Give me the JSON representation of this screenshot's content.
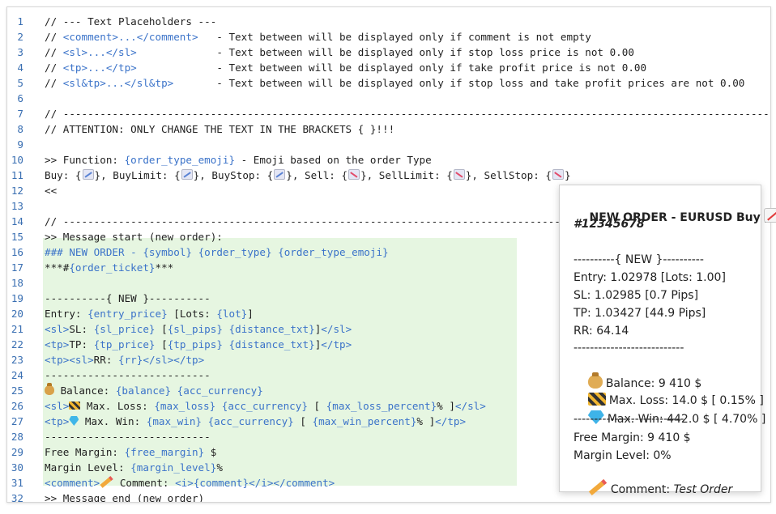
{
  "code": {
    "lines": [
      {
        "n": "1",
        "segments": [
          {
            "t": "// --- Text Placeholders ---"
          }
        ]
      },
      {
        "n": "2",
        "segments": [
          {
            "t": "// "
          },
          {
            "t": "<comment>...</comment>",
            "c": "b"
          },
          {
            "t": "   - Text between will be displayed only if comment is not empty"
          }
        ]
      },
      {
        "n": "3",
        "segments": [
          {
            "t": "// "
          },
          {
            "t": "<sl>...</sl>",
            "c": "b"
          },
          {
            "t": "             - Text between will be displayed only if stop loss price is not 0.00"
          }
        ]
      },
      {
        "n": "4",
        "segments": [
          {
            "t": "// "
          },
          {
            "t": "<tp>...</tp>",
            "c": "b"
          },
          {
            "t": "             - Text between will be displayed only if take profit price is not 0.00"
          }
        ]
      },
      {
        "n": "5",
        "segments": [
          {
            "t": "// "
          },
          {
            "t": "<sl&tp>...</sl&tp>",
            "c": "b"
          },
          {
            "t": "       - Text between will be displayed only if stop loss and take profit prices are not 0.00"
          }
        ]
      },
      {
        "n": "6",
        "segments": []
      },
      {
        "n": "7",
        "segments": [
          {
            "t": "// --------------------------------------------------------------------------------------------------------------------"
          }
        ]
      },
      {
        "n": "8",
        "segments": [
          {
            "t": "// ATTENTION: ONLY CHANGE THE TEXT IN THE BRACKETS { }!!!"
          }
        ]
      },
      {
        "n": "9",
        "segments": []
      },
      {
        "n": "10",
        "segments": [
          {
            "t": ">> Function: "
          },
          {
            "t": "{order_type_emoji}",
            "c": "b"
          },
          {
            "t": " - Emoji based on the order Type"
          }
        ]
      },
      {
        "n": "11",
        "segments": [
          {
            "t": "Buy: {"
          },
          {
            "e": "up"
          },
          {
            "t": "}, BuyLimit: {"
          },
          {
            "e": "up"
          },
          {
            "t": "}, BuyStop: {"
          },
          {
            "e": "up"
          },
          {
            "t": "}, Sell: {"
          },
          {
            "e": "down"
          },
          {
            "t": "}, SellLimit: {"
          },
          {
            "e": "down"
          },
          {
            "t": "}, SellStop: {"
          },
          {
            "e": "down"
          },
          {
            "t": "}"
          }
        ]
      },
      {
        "n": "12",
        "segments": [
          {
            "t": "<<"
          }
        ]
      },
      {
        "n": "13",
        "segments": []
      },
      {
        "n": "14",
        "segments": [
          {
            "t": "// --------------------------------------------------------------------------------------------------------------------"
          }
        ]
      },
      {
        "n": "15",
        "segments": [
          {
            "t": ">> Message start (new order):"
          }
        ]
      },
      {
        "n": "16",
        "segments": [
          {
            "t": "### NEW ORDER - ",
            "c": "b"
          },
          {
            "t": "{symbol} {order_type} {order_type_emoji}",
            "c": "b"
          }
        ]
      },
      {
        "n": "17",
        "segments": [
          {
            "t": "***#"
          },
          {
            "t": "{order_ticket}",
            "c": "b"
          },
          {
            "t": "***"
          }
        ]
      },
      {
        "n": "18",
        "segments": []
      },
      {
        "n": "19",
        "segments": [
          {
            "t": "----------{ NEW }----------"
          }
        ]
      },
      {
        "n": "20",
        "segments": [
          {
            "t": "Entry: "
          },
          {
            "t": "{entry_price}",
            "c": "b"
          },
          {
            "t": " [Lots: "
          },
          {
            "t": "{lot}",
            "c": "b"
          },
          {
            "t": "]"
          }
        ]
      },
      {
        "n": "21",
        "segments": [
          {
            "t": "<sl>",
            "c": "b"
          },
          {
            "t": "SL: "
          },
          {
            "t": "{sl_price}",
            "c": "b"
          },
          {
            "t": " ["
          },
          {
            "t": "{sl_pips}",
            "c": "b"
          },
          {
            "t": " "
          },
          {
            "t": "{distance_txt}",
            "c": "b"
          },
          {
            "t": "]"
          },
          {
            "t": "</sl>",
            "c": "b"
          }
        ]
      },
      {
        "n": "22",
        "segments": [
          {
            "t": "<tp>",
            "c": "b"
          },
          {
            "t": "TP: "
          },
          {
            "t": "{tp_price}",
            "c": "b"
          },
          {
            "t": " ["
          },
          {
            "t": "{tp_pips}",
            "c": "b"
          },
          {
            "t": " "
          },
          {
            "t": "{distance_txt}",
            "c": "b"
          },
          {
            "t": "]"
          },
          {
            "t": "</tp>",
            "c": "b"
          }
        ]
      },
      {
        "n": "23",
        "segments": [
          {
            "t": "<tp><sl>",
            "c": "b"
          },
          {
            "t": "RR: "
          },
          {
            "t": "{rr}",
            "c": "b"
          },
          {
            "t": "</sl></tp>",
            "c": "b"
          }
        ]
      },
      {
        "n": "24",
        "segments": [
          {
            "t": "---------------------------"
          }
        ]
      },
      {
        "n": "25",
        "segments": [
          {
            "e": "moneybag"
          },
          {
            "t": " Balance: "
          },
          {
            "t": "{balance}",
            "c": "b"
          },
          {
            "t": " "
          },
          {
            "t": "{acc_currency}",
            "c": "b"
          }
        ]
      },
      {
        "n": "26",
        "segments": [
          {
            "t": "<sl>",
            "c": "b"
          },
          {
            "e": "barrier"
          },
          {
            "t": " Max. Loss: "
          },
          {
            "t": "{max_loss}",
            "c": "b"
          },
          {
            "t": " "
          },
          {
            "t": "{acc_currency}",
            "c": "b"
          },
          {
            "t": " [ "
          },
          {
            "t": "{max_loss_percent}",
            "c": "b"
          },
          {
            "t": "% ]"
          },
          {
            "t": "</sl>",
            "c": "b"
          }
        ]
      },
      {
        "n": "27",
        "segments": [
          {
            "t": "<tp>",
            "c": "b"
          },
          {
            "e": "gem"
          },
          {
            "t": " Max. Win: "
          },
          {
            "t": "{max_win}",
            "c": "b"
          },
          {
            "t": " "
          },
          {
            "t": "{acc_currency}",
            "c": "b"
          },
          {
            "t": " [ "
          },
          {
            "t": "{max_win_percent}",
            "c": "b"
          },
          {
            "t": "% ]"
          },
          {
            "t": "</tp>",
            "c": "b"
          }
        ]
      },
      {
        "n": "28",
        "segments": [
          {
            "t": "---------------------------"
          }
        ]
      },
      {
        "n": "29",
        "segments": [
          {
            "t": "Free Margin: "
          },
          {
            "t": "{free_margin}",
            "c": "b"
          },
          {
            "t": " $"
          }
        ]
      },
      {
        "n": "30",
        "segments": [
          {
            "t": "Margin Level: "
          },
          {
            "t": "{margin_level}",
            "c": "b"
          },
          {
            "t": "%"
          }
        ]
      },
      {
        "n": "31",
        "segments": [
          {
            "t": "<comment>",
            "c": "b"
          },
          {
            "e": "pencil"
          },
          {
            "t": " Comment: "
          },
          {
            "t": "<i>",
            "c": "b"
          },
          {
            "t": "{comment}",
            "c": "b"
          },
          {
            "t": "</i></comment>",
            "c": "b"
          }
        ]
      },
      {
        "n": "32",
        "segments": [
          {
            "t": ">> Message end (new order)"
          }
        ]
      }
    ]
  },
  "preview": {
    "title": "NEW ORDER - EURUSD Buy",
    "ticket": "#12345678",
    "separator_new": "----------{ NEW }----------",
    "entry": "Entry: 1.02978 [Lots: 1.00]",
    "sl": "SL: 1.02985 [0.7 Pips]",
    "tp": "TP: 1.03427 [44.9 Pips]",
    "rr": "RR: 64.14",
    "separator": "---------------------------",
    "balance": "Balance: 9 410 $",
    "max_loss": "Max. Loss: 14.0 $ [ 0.15% ]",
    "max_win": "Max. Win: 442.0 $ [ 4.70% ]",
    "separator2": "---------------------------",
    "free_margin": "Free Margin: 9 410 $",
    "margin_level": "Margin Level: 0%",
    "comment_label": "Comment: ",
    "comment_value": "Test Order"
  },
  "icons": {
    "emoji_up": "chart-increasing-icon",
    "emoji_down": "chart-decreasing-icon",
    "balance": "money-bag-icon",
    "loss": "construction-barrier-icon",
    "win": "gem-icon",
    "comment": "pencil-icon"
  },
  "colors": {
    "placeholder_blue": "#3b73c9",
    "highlight_green": "#e6f6e1",
    "line_number_blue": "#3a6fb2"
  }
}
